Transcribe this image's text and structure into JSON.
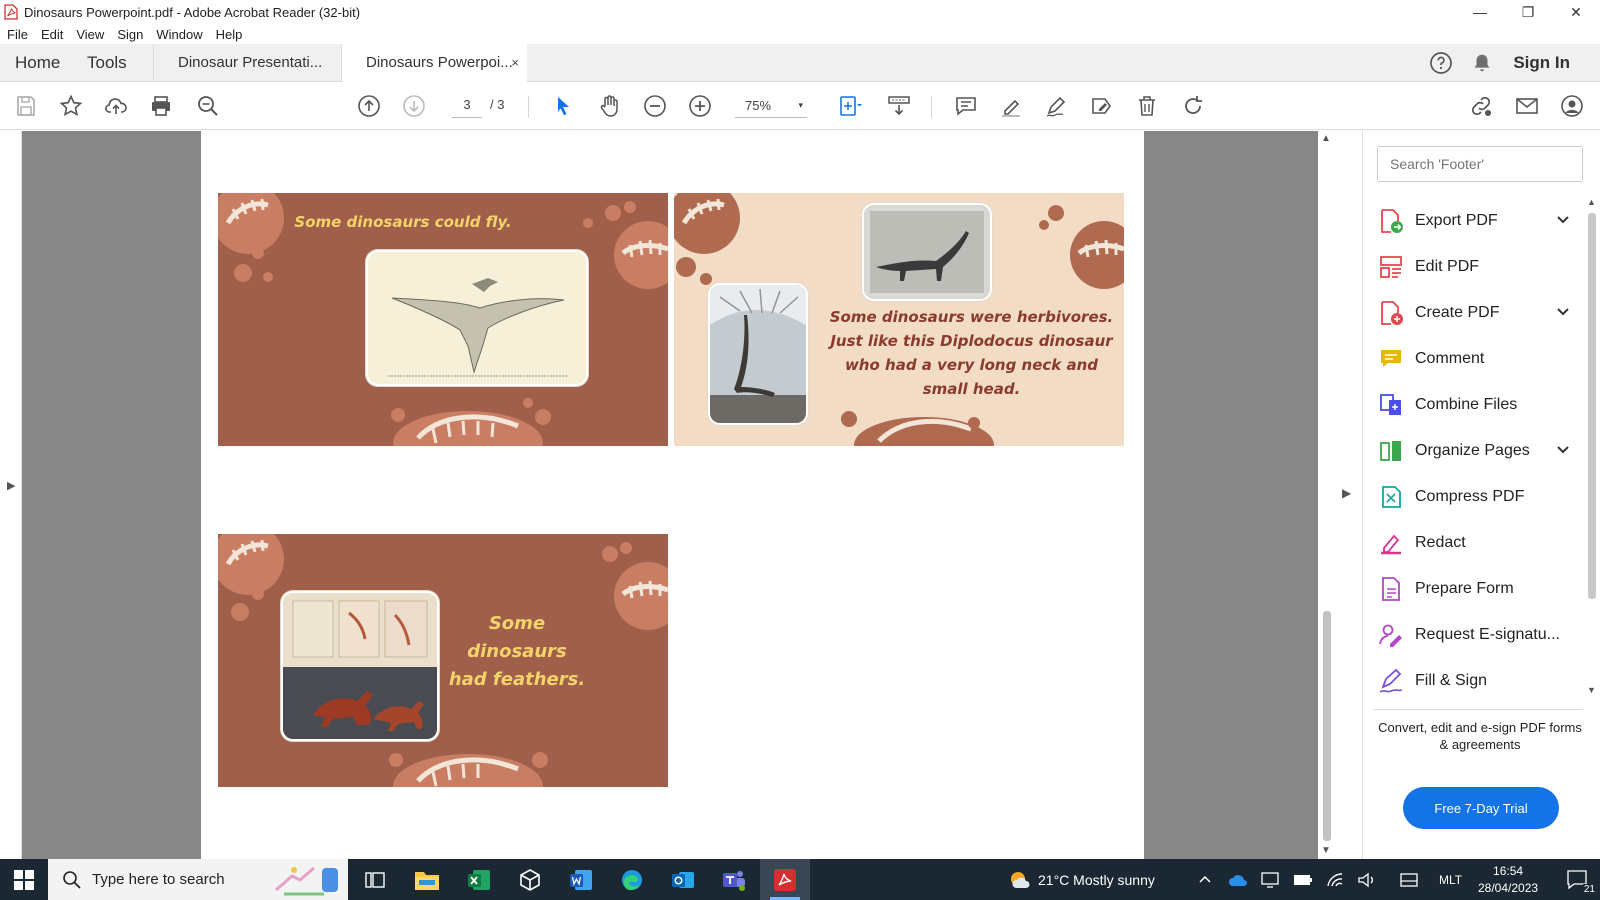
{
  "window": {
    "title": "Dinosaurs Powerpoint.pdf - Adobe Acrobat Reader (32-bit)",
    "buttons": [
      "—",
      "❐",
      "✕"
    ]
  },
  "menu": [
    "File",
    "Edit",
    "View",
    "Sign",
    "Window",
    "Help"
  ],
  "tabs": {
    "home": "Home",
    "tools": "Tools",
    "documents": [
      "Dinosaur Presentati...",
      "Dinosaurs Powerpoi..."
    ],
    "close": "×",
    "sign_in": "Sign In"
  },
  "toolbar": {
    "current_page": "3",
    "total_pages": "/ 3",
    "zoom": "75%",
    "zoom_caret": "▾"
  },
  "slides": {
    "fly": {
      "caption": "Some dinosaurs could fly."
    },
    "herbivores": {
      "caption": "Some dinosaurs were herbivores. Just like this Diplodocus dinosaur who had a very long neck and small head."
    },
    "feathers": {
      "caption_line1": "Some dinosaurs",
      "caption_line2": "had feathers."
    }
  },
  "right_panel": {
    "search_placeholder": "Search 'Footer'",
    "tools": [
      {
        "label": "Export PDF",
        "icon": "export-pdf-icon",
        "color": "#e34850",
        "expandable": true
      },
      {
        "label": "Edit PDF",
        "icon": "edit-pdf-icon",
        "color": "#e34850",
        "expandable": false
      },
      {
        "label": "Create PDF",
        "icon": "create-pdf-icon",
        "color": "#e34850",
        "expandable": true
      },
      {
        "label": "Comment",
        "icon": "comment-icon",
        "color": "#e8b800",
        "expandable": false
      },
      {
        "label": "Combine Files",
        "icon": "combine-files-icon",
        "color": "#4b4ee8",
        "expandable": false
      },
      {
        "label": "Organize Pages",
        "icon": "organize-pages-icon",
        "color": "#3da74e",
        "expandable": true
      },
      {
        "label": "Compress PDF",
        "icon": "compress-pdf-icon",
        "color": "#e34850",
        "expandable": false
      },
      {
        "label": "Redact",
        "icon": "redact-icon",
        "color": "#d83790",
        "expandable": false
      },
      {
        "label": "Prepare Form",
        "icon": "prepare-form-icon",
        "color": "#b347c9",
        "expandable": false
      },
      {
        "label": "Request E-signatu...",
        "icon": "request-esignature-icon",
        "color": "#b347c9",
        "expandable": false
      },
      {
        "label": "Fill & Sign",
        "icon": "fill-sign-icon",
        "color": "#7b4fd6",
        "expandable": false
      }
    ],
    "promo": "Convert, edit and e-sign PDF forms & agreements",
    "trial_button": "Free 7-Day Trial"
  },
  "taskbar": {
    "search_placeholder": "Type here to search",
    "weather": "21°C  Mostly sunny",
    "language": "MLT",
    "time": "16:54",
    "date": "28/04/2023",
    "notifications": "21"
  },
  "colors": {
    "slide_brown": "#a05f4b",
    "slide_cream": "#f2dcc6",
    "caption_yellow": "#f4d36a",
    "caption_brown": "#8a3b2c",
    "accent": "#1473e6"
  }
}
